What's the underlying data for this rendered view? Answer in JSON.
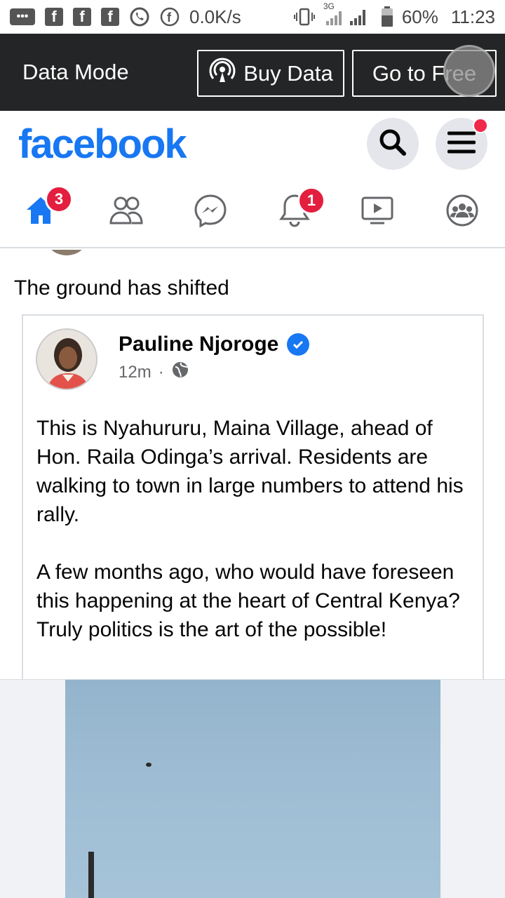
{
  "status_bar": {
    "net_speed": "0.0K/s",
    "network": "3G",
    "battery": "60%",
    "time": "11:23"
  },
  "data_mode": {
    "label": "Data Mode",
    "buy_data": "Buy Data",
    "go_to_free": "Go to Free"
  },
  "header": {
    "logo": "facebook"
  },
  "nav": {
    "home_badge": "3",
    "notifications_badge": "1"
  },
  "post": {
    "text": "The ground has shifted",
    "shared": {
      "author": "Pauline Njoroge",
      "time": "12m",
      "separator": "·",
      "paragraph1": "This is Nyahururu, Maina Village, ahead of Hon. Raila Odinga’s arrival. Residents are walking to town in large numbers to attend his rally.",
      "paragraph2": "A few months ago, who would have foreseen this happening at the heart of Central Kenya? Truly politics is the art of the possible!"
    }
  },
  "colors": {
    "brand": "#1877f2",
    "badge": "#e41e3f",
    "data_bar": "#242526"
  }
}
